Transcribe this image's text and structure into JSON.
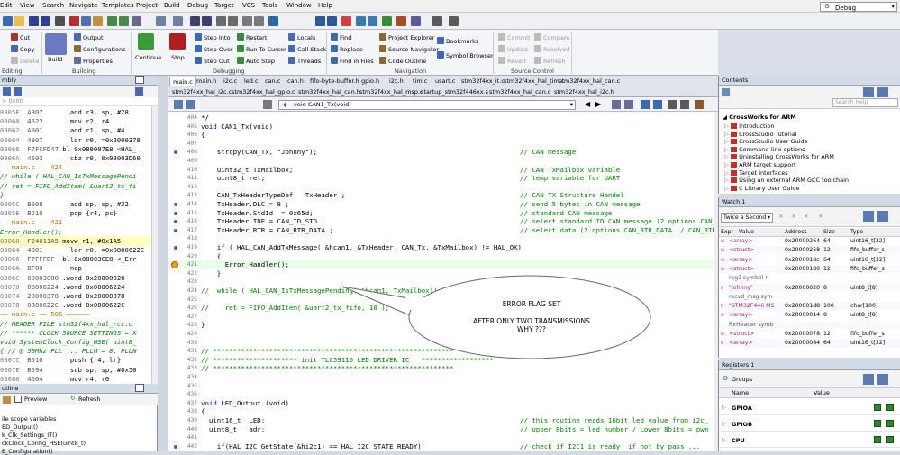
{
  "menu": [
    "Edit",
    "View",
    "Search",
    "Navigate",
    "Templates",
    "Project",
    "Build",
    "Debug",
    "Target",
    "VCS",
    "Tools",
    "Window",
    "Help"
  ],
  "config": "Debug",
  "ribbon": {
    "editing": {
      "cut": "Cut",
      "copy": "Copy",
      "delete": "Delete",
      "group": "Editing"
    },
    "building": {
      "build": "Build",
      "output": "Output",
      "configurations": "Configurations",
      "properties": "Properties",
      "group": "Building"
    },
    "debugging": {
      "continue": "Continue",
      "stop": "Stop",
      "step_into": "Step Into",
      "step_over": "Step Over",
      "step_out": "Step Out",
      "restart": "Restart",
      "run_to_cursor": "Run To Cursor",
      "auto_step": "Auto Step",
      "locals": "Locals",
      "call_stack": "Call Stack",
      "threads": "Threads",
      "group": "Debugging"
    },
    "navigation": {
      "find": "Find",
      "replace": "Replace",
      "find_in_files": "Find in Files",
      "project_explorer": "Project Explorer",
      "source_navigator": "Source Navigator",
      "code_outline": "Code Outline",
      "bookmarks": "Bookmarks",
      "symbol_browser": "Symbol Browser",
      "group": "Navigation"
    },
    "source_control": {
      "commit": "Commit",
      "compare": "Compare",
      "update": "Update",
      "resolved": "Resolved",
      "revert": "Revert",
      "refresh": "Refresh",
      "group": "Source Control"
    }
  },
  "disasm": {
    "title": "mbly",
    "addr_placeholder": "> 0x00",
    "lines": [
      {
        "t": "code",
        "a": "0305E",
        "h": "AB07",
        "i": "  add r3, sp, #28"
      },
      {
        "t": "code",
        "a": "03060",
        "h": "4622",
        "i": "  mov r2, r4"
      },
      {
        "t": "code",
        "a": "03062",
        "h": "A901",
        "i": "  add r1, sp, #4"
      },
      {
        "t": "code",
        "a": "03064",
        "h": "4807",
        "i": "  ldr r0, =0x2000378"
      },
      {
        "t": "code",
        "a": "03066",
        "h": "F7FCFD47",
        "i": "bl 0x080007E8 <HAL_"
      },
      {
        "t": "code",
        "a": "0306A",
        "h": "4603",
        "i": "  cbz r0, 0x08003D60"
      },
      {
        "t": "sep",
        "s": "—— main.c —— 424"
      },
      {
        "t": "src",
        "s": "// while ( HAL_CAN_IsTxMessagePendi"
      },
      {
        "t": "src",
        "s": "// ret = FIFO_AddItem( &uart2_tx_fi"
      },
      {
        "t": "src",
        "s": "}"
      },
      {
        "t": "code",
        "a": "0305C",
        "h": "B008",
        "i": "  add sp, sp, #32"
      },
      {
        "t": "code",
        "a": "0305E",
        "h": "BD10",
        "i": "  pop {r4, pc}"
      },
      {
        "t": "sep",
        "s": "—— main.c —— 421 ——————"
      },
      {
        "t": "src",
        "s": "Error_Handler();"
      },
      {
        "t": "cur",
        "a": "03060",
        "h": "F24011A5",
        "i": "movw r1, #0x1A5"
      },
      {
        "t": "code",
        "a": "03064",
        "h": "4801",
        "i": "  ldr r0, =0x0800622C"
      },
      {
        "t": "code",
        "a": "03066",
        "h": "F7FFFBF",
        "i": "bl 0x08003CE8 <_Err"
      },
      {
        "t": "code",
        "a": "0306A",
        "h": "BF00",
        "i": "  nop"
      },
      {
        "t": "code",
        "a": "0306C",
        "h": "00003000",
        "i": ".word 0x20000020"
      },
      {
        "t": "code",
        "a": "03070",
        "h": "08006224",
        "i": ".word 0x08006224"
      },
      {
        "t": "code",
        "a": "03074",
        "h": "20000378",
        "i": ".word 0x20000378"
      },
      {
        "t": "code",
        "a": "03078",
        "h": "0800622C",
        "i": ".word 0x0800622C"
      },
      {
        "t": "sep",
        "s": "—— main.c —— 506 ——————"
      },
      {
        "t": "src",
        "s": "// HEADER FILE stm32f4xx_hal_rcc.c"
      },
      {
        "t": "src",
        "s": "// ****** CLOCK SOURCE SETTINGS = X"
      },
      {
        "t": "src",
        "s": "void SystemClock_Config_HSE( uint8_"
      },
      {
        "t": "src",
        "s": "{ // @ 50Mhz PLL ... PLLM = 8, PLLN"
      },
      {
        "t": "code",
        "a": "0307C",
        "h": "B510",
        "i": "  push {r4, lr}"
      },
      {
        "t": "code",
        "a": "0307E",
        "h": "B094",
        "i": "  sub sp, sp, #0x50"
      },
      {
        "t": "code",
        "a": "03080",
        "h": "4604",
        "i": "  mov r4, r0"
      }
    ]
  },
  "outline": {
    "title": "utline",
    "preview": "Preview",
    "refresh": "Refresh",
    "items": [
      "ile scope variables",
      "ED_Output()",
      "k_Clk_Settings_IT()",
      "ckClock_Config_HSE(uint8_t)",
      "E_Configuration()"
    ]
  },
  "editor": {
    "tabs_row1": [
      "main.c",
      "main.h",
      "i2c.c",
      "led.c",
      "can.c",
      "can.h",
      "fifo-byte-buffer.h",
      "gpio.h",
      "i2c.h",
      "tim.c",
      "usart.c",
      "stm32f4xx_it.c",
      "stm32f4xx_hal_tim.c",
      "stm32f4xx_hal_can.c"
    ],
    "tabs_row2": [
      "stm32f4xx_hal_i2c.c",
      "stm32f4xx_hal_gpio.c",
      "stm32f4xx_hal_can.h",
      "stm32f4xx_hal_msp.c",
      "startup_stm32f446xx.s",
      "stm32f4xx_hal_can.c",
      "stm32f4xx_hal_i2c.h"
    ],
    "function": "void CAN1_Tx(void)",
    "lines": [
      {
        "n": "404",
        "c": "*/",
        "m": ""
      },
      {
        "n": "405",
        "c": "void CAN1_Tx(void)",
        "m": "",
        "k": true
      },
      {
        "n": "406",
        "c": "{",
        "m": ""
      },
      {
        "n": "407",
        "c": "",
        "m": ""
      },
      {
        "n": "408",
        "c": "    strcpy(CAN_Tx, \"Johnny\");",
        "m": "// CAN message",
        "dot": true
      },
      {
        "n": "409",
        "c": "",
        "m": ""
      },
      {
        "n": "410",
        "c": "    uint32_t TxMailbox;",
        "m": "// CAN TxMailbox variable"
      },
      {
        "n": "411",
        "c": "    uint8_t ret;",
        "m": "// temp variable for UART"
      },
      {
        "n": "412",
        "c": "",
        "m": ""
      },
      {
        "n": "413",
        "c": "    CAN_TxHeaderTypeDef   TxHeader ;",
        "m": "// CAN TX Structure Handel"
      },
      {
        "n": "414",
        "c": "    TxHeader.DLC = 8 ;",
        "m": "// send 5 bytes in CAN message",
        "dot": true
      },
      {
        "n": "415",
        "c": "    TxHeader.StdId  = 0x65d;",
        "m": "// standard CAN message",
        "dot": true
      },
      {
        "n": "416",
        "c": "    TxHeader.IDE = CAN_ID_STD ;",
        "m": "// select standard ID CAN message (2 options CAN_",
        "dot": true
      },
      {
        "n": "417",
        "c": "    TxHeader.RTR = CAN_RTR_DATA ;",
        "m": "// select data (2 options CAN_RTR_DATA  / CAN_RTR",
        "dot": true
      },
      {
        "n": "418",
        "c": "",
        "m": ""
      },
      {
        "n": "419",
        "c": "    if ( HAL_CAN_AddTxMessage( &hcan1, &TxHeader, CAN_Tx, &TxMailbox) != HAL_OK)",
        "m": "",
        "dot": true
      },
      {
        "n": "420",
        "c": "    {",
        "m": ""
      },
      {
        "n": "421",
        "c": "      Error_Handler();",
        "m": "",
        "bp": true,
        "hl": true
      },
      {
        "n": "422",
        "c": "    }",
        "m": ""
      },
      {
        "n": "423",
        "c": "",
        "m": ""
      },
      {
        "n": "424",
        "c": "//  while ( HAL_CAN_IsTxMessagePending( &hcan1, TxMailbox));",
        "m": "",
        "cmt": true
      },
      {
        "n": "425",
        "c": "",
        "m": ""
      },
      {
        "n": "426",
        "c": "//    ret = FIFO_AddItem( &uart2_tx_fifo, 10 );",
        "m": "",
        "cmt": true
      },
      {
        "n": "427",
        "c": "",
        "m": ""
      },
      {
        "n": "428",
        "c": "}",
        "m": ""
      },
      {
        "n": "429",
        "c": "",
        "m": ""
      },
      {
        "n": "430",
        "c": "",
        "m": ""
      },
      {
        "n": "431",
        "c": "// ************************************************************",
        "m": "",
        "cmt": true
      },
      {
        "n": "432",
        "c": "// ********************* init TLC59116 LED DRIVER IC   ******************",
        "m": "",
        "cmt": true
      },
      {
        "n": "433",
        "c": "// ************************************************************",
        "m": "",
        "cmt": true
      },
      {
        "n": "434",
        "c": "",
        "m": ""
      },
      {
        "n": "435",
        "c": "",
        "m": ""
      },
      {
        "n": "436",
        "c": "",
        "m": ""
      },
      {
        "n": "437",
        "c": "void LED_Output (void)",
        "m": "",
        "k": true
      },
      {
        "n": "438",
        "c": "{",
        "m": ""
      },
      {
        "n": "439",
        "c": "  uint16_t  LED;",
        "m": "// this routine reads 16bit led value from i2c_"
      },
      {
        "n": "440",
        "c": "  uint8_t   adr;",
        "m": "// upper 8bits = led number / Lower 8bits = pwm"
      },
      {
        "n": "441",
        "c": "",
        "m": ""
      },
      {
        "n": "442",
        "c": "    if(HAL_I2C_GetState(&hi2c1) == HAL_I2C_STATE_READY)",
        "m": "// check if I2C1 is ready  if not by pass ...",
        "dot": true
      }
    ]
  },
  "callout": {
    "line1": "ERROR FLAG SET",
    "line2": "AFTER ONLY TWO TRANSMISSIONS",
    "line3": "WHY ???"
  },
  "contents": {
    "title": "Contents",
    "search_placeholder": "Search Help",
    "root": "CrossWorks for ARM",
    "items": [
      "Introduction",
      "CrossStudio Tutorial",
      "CrossStudio User Guide",
      "Command-line options",
      "Uninstalling CrossWorks for ARM",
      "ARM target support",
      "Target interfaces",
      "Using an external ARM GCC toolchain",
      "C Library User Guide"
    ]
  },
  "watch": {
    "title": "Watch 1",
    "selector": "Twice a Second",
    "columns": [
      "Expr",
      "Value",
      "Address",
      "Size",
      "Type"
    ],
    "rows": [
      [
        "u",
        "<array>",
        "0x20000264",
        "64",
        "uint16_t[32]"
      ],
      [
        "u",
        "<struct>",
        "0x20000258",
        "12",
        "fifo_buffer_s"
      ],
      [
        "u",
        "<array>",
        "0x2000018c",
        "64",
        "uint16_t[32]"
      ],
      [
        "u",
        "<struct>",
        "0x20000180",
        "12",
        "fifo_buffer_s"
      ],
      [
        "",
        "reg2 symbol n",
        "",
        "",
        ""
      ],
      [
        "r",
        "\"Johnny\"",
        "0x20000020",
        "8",
        "uint8_t[8]"
      ],
      [
        "",
        "recvd_msg sym",
        "",
        "",
        ""
      ],
      [
        "r",
        "\"STM32F446 MS",
        "0x200001d8",
        "100",
        "char[100]"
      ],
      [
        "c",
        "<array>",
        "0x20000014",
        "8",
        "uint8_t[8]"
      ],
      [
        "",
        "RxHeader symb",
        "",
        "",
        ""
      ],
      [
        "u",
        "<struct>",
        "0x20000078",
        "12",
        "fifo_buffer_s"
      ],
      [
        "c",
        "<array>",
        "0x20000084",
        "64",
        "uint16_t[32]"
      ]
    ]
  },
  "registers": {
    "title": "Registers 1",
    "groups": "Groups",
    "columns": [
      "Name",
      "Value"
    ],
    "rows": [
      "GPIOA",
      "GPIOB",
      "CPU"
    ]
  },
  "colors": {
    "accent": "#4060c0",
    "comment": "#008000",
    "keyword": "#0000c0"
  }
}
